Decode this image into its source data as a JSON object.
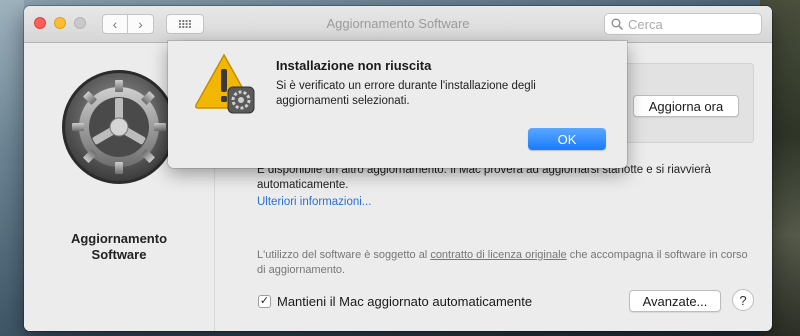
{
  "window": {
    "title": "Aggiornamento Software",
    "search_placeholder": "Cerca"
  },
  "sidebar": {
    "title_line1": "Aggiornamento",
    "title_line2": "Software"
  },
  "main": {
    "update_button": "Aggiorna ora",
    "info_text": "È disponibile un altro aggiornamento. Il Mac proverà ad aggiornarsi stanotte e si riavvierà automaticamente.",
    "more_link": "Ulteriori informazioni...",
    "license_prefix": "L'utilizzo del software è soggetto al ",
    "license_link": "contratto di licenza originale",
    "license_suffix": " che accompagna il software in corso di aggiornamento.",
    "auto_update_label": "Mantieni il Mac aggiornato automaticamente",
    "auto_update_checked": true,
    "advanced_button": "Avanzate...",
    "help_button": "?"
  },
  "alert": {
    "title": "Installazione non riuscita",
    "message": "Si è verificato un errore durante l'installazione degli aggiornamenti selezionati.",
    "ok_button": "OK"
  },
  "colors": {
    "accent": "#1a7bff",
    "link": "#2a6fd6",
    "close": "#ff5f57",
    "minimize": "#febc2e"
  },
  "icons": [
    "back-icon",
    "forward-icon",
    "grid-icon",
    "search-icon",
    "gear-icon",
    "warning-icon"
  ]
}
